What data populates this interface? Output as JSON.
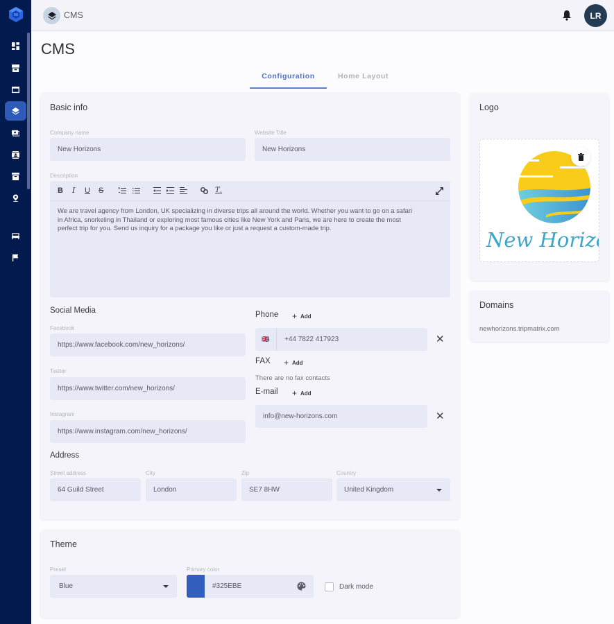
{
  "app": {
    "breadcrumb": "CMS",
    "page_title": "CMS",
    "user_initials": "LR"
  },
  "sidebar": {
    "items": [
      {
        "icon": "dashboard-icon"
      },
      {
        "icon": "inventory-icon"
      },
      {
        "icon": "browser-icon"
      },
      {
        "icon": "layers-icon",
        "active": true
      },
      {
        "icon": "payments-icon"
      },
      {
        "icon": "contacts-icon"
      },
      {
        "icon": "archive-icon"
      },
      {
        "icon": "location-pin-icon"
      },
      {
        "icon": "hotel-bed-icon"
      },
      {
        "icon": "flag-icon"
      }
    ]
  },
  "tabs": [
    {
      "label": "Configuration",
      "active": true
    },
    {
      "label": "Home Layout",
      "active": false
    }
  ],
  "basic_info": {
    "title": "Basic info",
    "company_name": {
      "label": "Company name",
      "value": "New Horizons"
    },
    "website_title": {
      "label": "Website Title",
      "value": "New Horizons"
    },
    "description": {
      "label": "Description",
      "toolbar": [
        "B",
        "I",
        "U",
        "S",
        "ordered-list",
        "bullet-list",
        "indent-decrease",
        "indent-increase",
        "align-left",
        "link",
        "clear-format",
        "expand"
      ],
      "lines": [
        "We are travel agency from London, UK specializing in diverse trips all around the world. Whether you want to go on a safari",
        "in Africa, snorkeling in Thailand or exploring most famous cities like New York and Paris, we are here to create the most",
        "perfect trip for you. Send us inquiry for a package you like or just a request a custom-made trip."
      ]
    }
  },
  "social": {
    "title": "Social Media",
    "facebook": {
      "label": "Facebook",
      "value": "https://www.facebook.com/new_horizons/"
    },
    "twitter": {
      "label": "Twitter",
      "value": "https://www.twitter.com/new_horizons/"
    },
    "instagram": {
      "label": "Instagram",
      "value": "https://www.instagram.com/new_horizons/"
    }
  },
  "contacts": {
    "add_label": "Add",
    "phone": {
      "title": "Phone",
      "flag": "🇬🇧",
      "value": "+44 7822 417923"
    },
    "fax": {
      "title": "FAX",
      "empty": "There are no fax contacts"
    },
    "email": {
      "title": "E-mail",
      "value": "info@new-horizons.com"
    }
  },
  "address": {
    "title": "Address",
    "street": {
      "label": "Street address",
      "value": "64 Guild Street"
    },
    "city": {
      "label": "City",
      "value": "London"
    },
    "zip": {
      "label": "Zip",
      "value": "SE7 8HW"
    },
    "country": {
      "label": "Country",
      "value": "United Kingdom"
    }
  },
  "theme": {
    "title": "Theme",
    "preset": {
      "label": "Preset",
      "value": "Blue"
    },
    "primary_color": {
      "label": "Primary color",
      "value": "#325EBE"
    },
    "dark_mode": {
      "label": "Dark mode",
      "checked": false
    }
  },
  "logo": {
    "title": "Logo",
    "image_text": "New Horizons"
  },
  "domains": {
    "title": "Domains",
    "items": [
      "newhorizons.tripmatrix.com"
    ]
  },
  "colors": {
    "sidebar_bg": "#031a4f",
    "accent": "#325EBE",
    "active_tab": "#4f72c6"
  }
}
